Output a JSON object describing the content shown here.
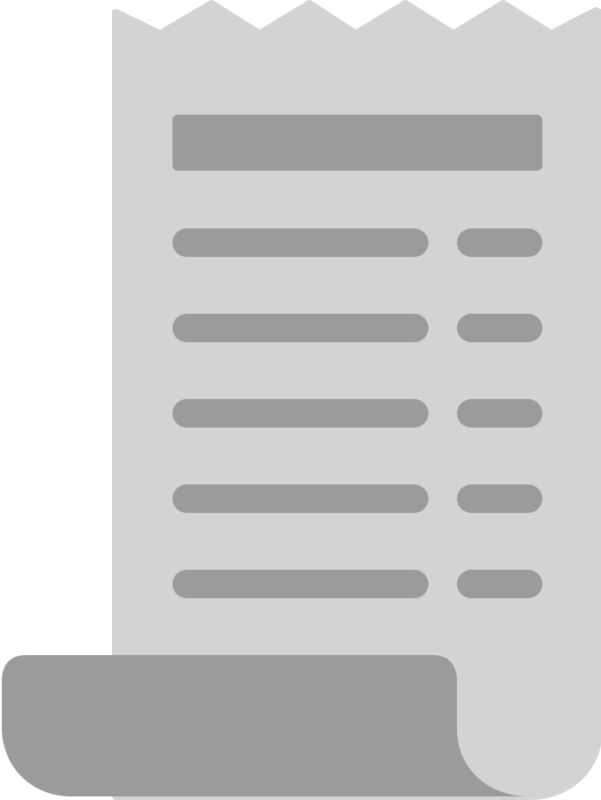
{
  "icon": {
    "name": "receipt-icon",
    "colors": {
      "paper": "#d3d3d3",
      "ink": "#9b9b9b",
      "background": "#ffffff"
    }
  }
}
